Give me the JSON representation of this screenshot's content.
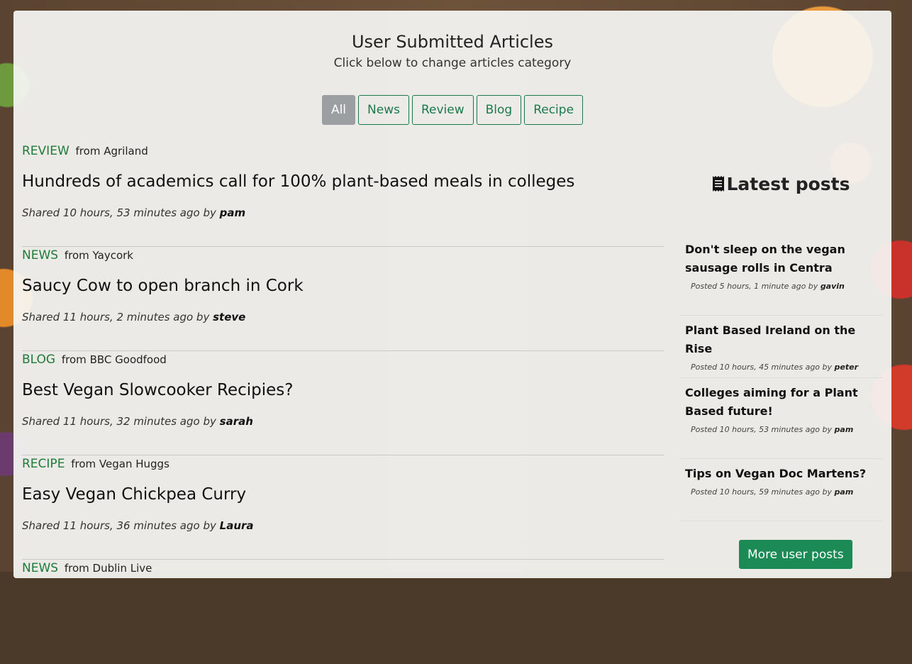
{
  "header": {
    "title": "User Submitted Articles",
    "subtitle": "Click below to change articles category"
  },
  "filters": [
    {
      "label": "All",
      "active": true
    },
    {
      "label": "News",
      "active": false
    },
    {
      "label": "Review",
      "active": false
    },
    {
      "label": "Blog",
      "active": false
    },
    {
      "label": "Recipe",
      "active": false
    }
  ],
  "articles": [
    {
      "category": "REVIEW",
      "from_word": "from",
      "source": "Agriland",
      "title": "Hundreds of academics call for 100% plant-based meals in colleges",
      "shared_prefix": "Shared 10 hours, 53 minutes ago by",
      "user": "pam"
    },
    {
      "category": "NEWS",
      "from_word": "from",
      "source": "Yaycork",
      "title": "Saucy Cow to open branch in Cork",
      "shared_prefix": "Shared 11 hours, 2 minutes ago by",
      "user": "steve"
    },
    {
      "category": "BLOG",
      "from_word": "from",
      "source": "BBC Goodfood",
      "title": "Best Vegan Slowcooker Recipies?",
      "shared_prefix": "Shared 11 hours, 32 minutes ago by",
      "user": "sarah"
    },
    {
      "category": "RECIPE",
      "from_word": "from",
      "source": "Vegan Huggs",
      "title": "Easy Vegan Chickpea Curry",
      "shared_prefix": "Shared 11 hours, 36 minutes ago by",
      "user": "Laura"
    },
    {
      "category": "NEWS",
      "from_word": "from",
      "source": "Dublin Live",
      "title": "",
      "shared_prefix": "",
      "user": ""
    }
  ],
  "sidebar": {
    "heading": "Latest posts",
    "heading_icon": "receipt-icon",
    "posts": [
      {
        "title": "Don't sleep on the vegan sausage rolls in Centra",
        "posted_prefix": "Posted 5 hours, 1 minute ago by",
        "user": "gavin"
      },
      {
        "title": "Plant Based Ireland on the Rise",
        "posted_prefix": "Posted 10 hours, 45 minutes ago by",
        "user": "peter"
      },
      {
        "title": "Colleges aiming for a Plant Based future!",
        "posted_prefix": "Posted 10 hours, 53 minutes ago by",
        "user": "pam"
      },
      {
        "title": "Tips on Vegan Doc Martens?",
        "posted_prefix": "Posted 10 hours, 59 minutes ago by",
        "user": "pam"
      }
    ],
    "more_label": "More user posts"
  },
  "colors": {
    "accent": "#1b7a4b",
    "category_green": "#1e7b3a",
    "active_filter": "#9b9fa2",
    "more_button": "#1b8a55"
  }
}
